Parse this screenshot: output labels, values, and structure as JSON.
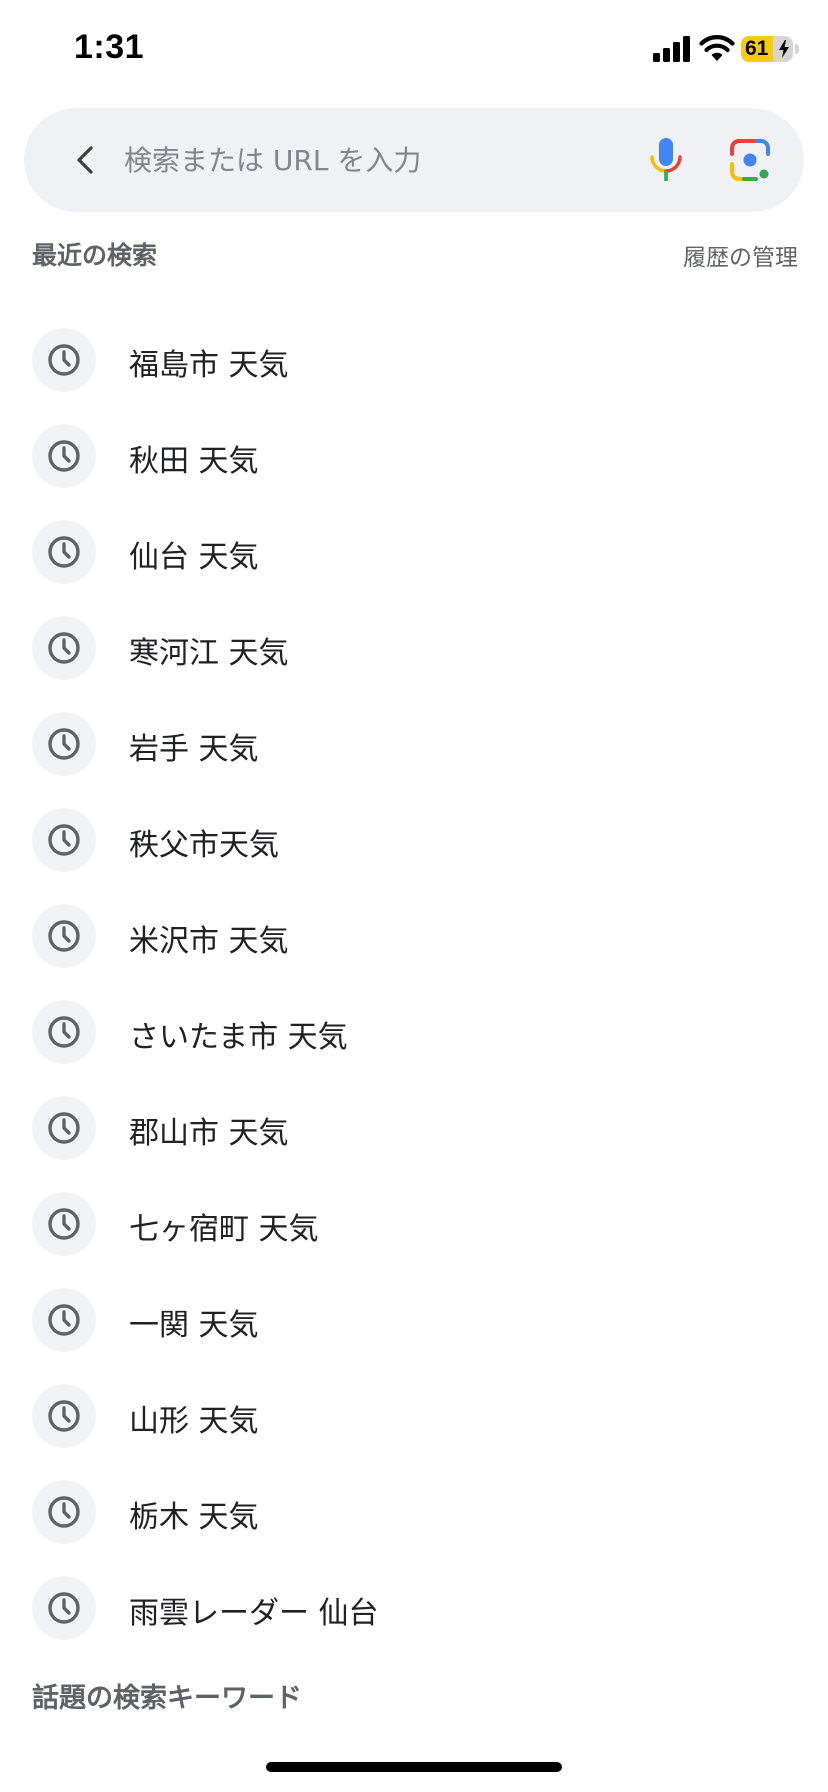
{
  "status_bar": {
    "time": "1:31",
    "battery_level": "61",
    "battery_fraction": 0.61,
    "battery_color": "#f7cc0d",
    "icons": [
      "signal-icon",
      "wifi-icon",
      "battery-icon",
      "charging-bolt-icon"
    ]
  },
  "search": {
    "placeholder": "検索または URL を入力",
    "value": "",
    "back_icon": "chevron-left-icon",
    "mic_icon": "microphone-icon",
    "lens_icon": "camera-lens-icon"
  },
  "recent": {
    "title": "最近の検索",
    "manage_label": "履歴の管理",
    "item_icon": "clock-icon",
    "items": [
      {
        "label": "福島市 天気"
      },
      {
        "label": "秋田 天気"
      },
      {
        "label": "仙台 天気"
      },
      {
        "label": "寒河江 天気"
      },
      {
        "label": "岩手 天気"
      },
      {
        "label": "秩父市天気"
      },
      {
        "label": "米沢市 天気"
      },
      {
        "label": "さいたま市 天気"
      },
      {
        "label": "郡山市 天気"
      },
      {
        "label": "七ヶ宿町 天気"
      },
      {
        "label": "一関 天気"
      },
      {
        "label": "山形 天気"
      },
      {
        "label": "栃木 天気"
      },
      {
        "label": "雨雲レーダー 仙台"
      }
    ]
  },
  "trending": {
    "title": "話題の検索キーワード"
  },
  "colors": {
    "search_bg": "#eff1f4",
    "secondary_text": "#5f6368",
    "primary_text": "#202124",
    "google_blue": "#4285f4",
    "google_red": "#ea4335",
    "google_yellow": "#fbbc04",
    "google_green": "#34a853"
  }
}
